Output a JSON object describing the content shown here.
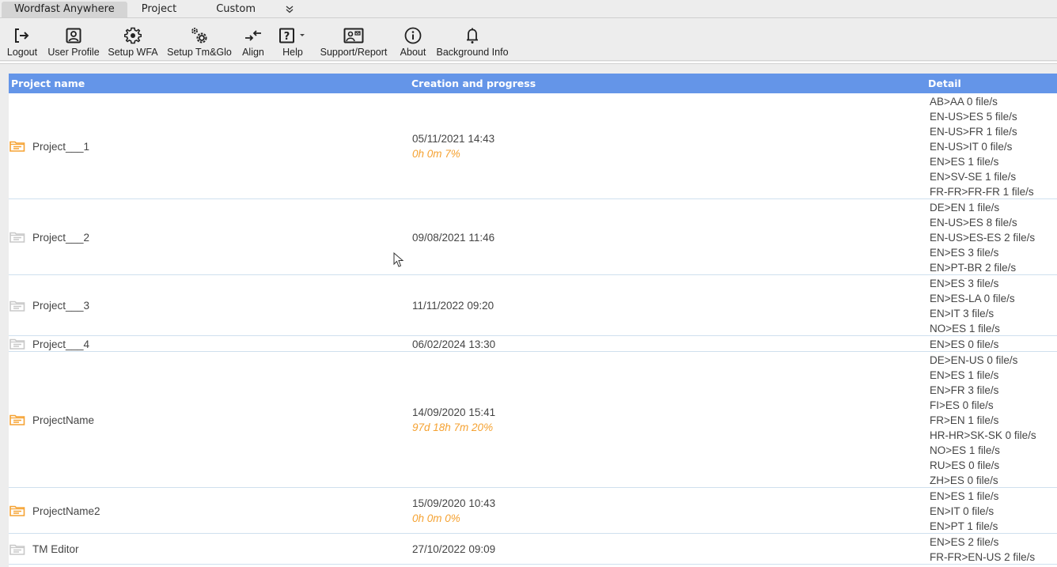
{
  "menubar": {
    "tabs": [
      {
        "label": "Wordfast Anywhere",
        "active": true
      },
      {
        "label": "Project",
        "active": false
      },
      {
        "label": "Custom",
        "active": false
      }
    ],
    "more_icon": "double-chevron-down-icon"
  },
  "toolbar": {
    "buttons": [
      {
        "label": "Logout",
        "icon": "logout-icon"
      },
      {
        "label": "User Profile",
        "icon": "user-profile-icon"
      },
      {
        "label": "Setup WFA",
        "icon": "gear-icon"
      },
      {
        "label": "Setup Tm&Glo",
        "icon": "gears-icon"
      },
      {
        "label": "Align",
        "icon": "align-icon"
      },
      {
        "label": "Help",
        "icon": "help-icon"
      },
      {
        "label": "Support/Report",
        "icon": "support-report-icon"
      },
      {
        "label": "About",
        "icon": "info-icon"
      },
      {
        "label": "Background Info",
        "icon": "bell-icon"
      }
    ]
  },
  "table": {
    "headers": {
      "name": "Project name",
      "creation": "Creation and progress",
      "detail": "Detail"
    },
    "colors": {
      "header_bg": "#6495e8",
      "progress": "#f5a232",
      "folder_active": "#f5a232",
      "folder_inactive": "#c8c8c8"
    },
    "rows": [
      {
        "name": "Project___1",
        "active": true,
        "date": "05/11/2021 14:43",
        "progress": "0h 0m 7%",
        "details": [
          "AB>AA 0 file/s",
          "EN-US>ES 5 file/s",
          "EN-US>FR 1 file/s",
          "EN-US>IT 0 file/s",
          "EN>ES 1 file/s",
          "EN>SV-SE 1 file/s",
          "FR-FR>FR-FR 1 file/s"
        ]
      },
      {
        "name": "Project___2",
        "active": false,
        "date": "09/08/2021 11:46",
        "progress": "",
        "details": [
          "DE>EN 1 file/s",
          "EN-US>ES 8 file/s",
          "EN-US>ES-ES 2 file/s",
          "EN>ES 3 file/s",
          "EN>PT-BR 2 file/s"
        ]
      },
      {
        "name": "Project___3",
        "active": false,
        "date": "11/11/2022 09:20",
        "progress": "",
        "details": [
          "EN>ES 3 file/s",
          "EN>ES-LA 0 file/s",
          "EN>IT 3 file/s",
          "NO>ES 1 file/s"
        ]
      },
      {
        "name": "Project___4",
        "active": false,
        "date": "06/02/2024 13:30",
        "progress": "",
        "details": [
          "EN>ES 0 file/s"
        ]
      },
      {
        "name": "ProjectName",
        "active": true,
        "date": "14/09/2020 15:41",
        "progress": "97d 18h 7m 20%",
        "details": [
          "DE>EN-US 0 file/s",
          "EN>ES 1 file/s",
          "EN>FR 3 file/s",
          "FI>ES 0 file/s",
          "FR>EN 1 file/s",
          "HR-HR>SK-SK 0 file/s",
          "NO>ES 1 file/s",
          "RU>ES 0 file/s",
          "ZH>ES 0 file/s"
        ]
      },
      {
        "name": "ProjectName2",
        "active": true,
        "date": "15/09/2020 10:43",
        "progress": "0h 0m 0%",
        "details": [
          "EN>ES 1 file/s",
          "EN>IT 0 file/s",
          "EN>PT 1 file/s"
        ]
      },
      {
        "name": "TM Editor",
        "active": false,
        "date": "27/10/2022 09:09",
        "progress": "",
        "details": [
          "EN>ES 2 file/s",
          "FR-FR>EN-US 2 file/s"
        ]
      }
    ]
  }
}
